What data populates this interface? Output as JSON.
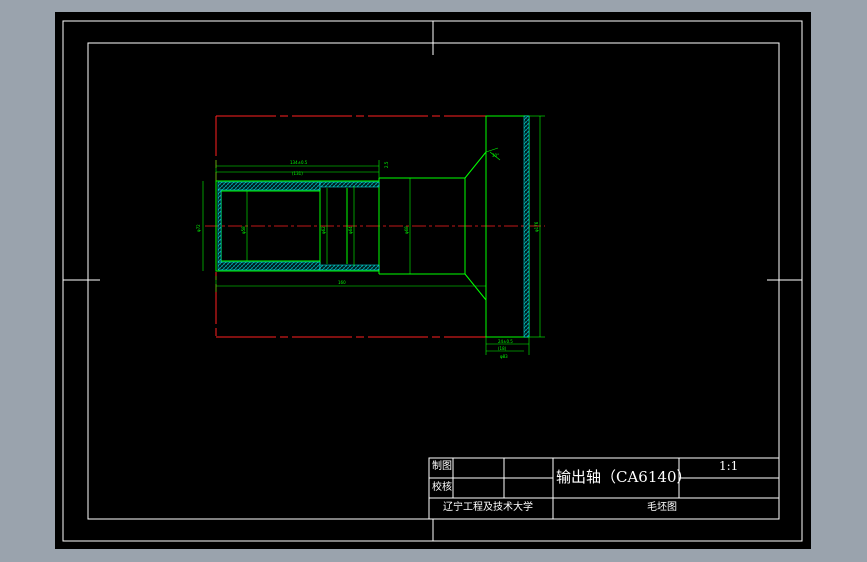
{
  "title_block": {
    "drawn_label": "制图",
    "checked_label": "校核",
    "part_name": "输出轴（CA6140）",
    "scale": "1:1",
    "school": "辽宁工程及技术大学",
    "drawing_type": "毛坯图"
  },
  "dimensions": {
    "len_top1": "134±0.5",
    "len_top2": "(131)",
    "len_bottom": "160",
    "dia_left": "φ72",
    "dia_mid1": "φ58",
    "dia_mid2": "φ62",
    "dia_mid3": "φ64",
    "dia_step": "φ68",
    "dia_flange": "φ176",
    "small_step": "2.5",
    "angle": "30°",
    "flange_w1": "24±0.5",
    "flange_w2": "(18)",
    "flange_w3": "φ83"
  },
  "colors": {
    "background": "#9aa3ad",
    "paper": "#000000",
    "frame": "#ffffff",
    "outline": "#00ff00",
    "stock_outline": "#ff0000",
    "centerline": "#ff0000",
    "hatch": "#00ffff"
  }
}
